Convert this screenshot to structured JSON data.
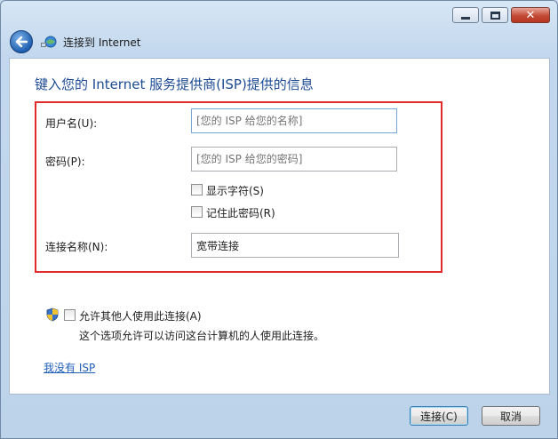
{
  "window": {
    "title": "连接到 Internet",
    "caption_buttons": [
      "minimize-icon",
      "maximize-icon",
      "close-icon"
    ]
  },
  "main": {
    "heading": "键入您的 Internet 服务提供商(ISP)提供的信息",
    "username": {
      "label": "用户名(U):",
      "placeholder": "[您的 ISP 给您的名称]",
      "value": ""
    },
    "password": {
      "label": "密码(P):",
      "placeholder": "[您的 ISP 给您的密码]",
      "value": ""
    },
    "show_chars": {
      "label": "显示字符(S)",
      "checked": false
    },
    "remember_pw": {
      "label": "记住此密码(R)",
      "checked": false
    },
    "conn_name": {
      "label": "连接名称(N):",
      "value": "宽带连接"
    },
    "allow_others": {
      "label": "允许其他人使用此连接(A)",
      "desc": "这个选项允许可以访问这台计算机的人使用此连接。",
      "checked": false,
      "icon": "shield-icon"
    },
    "no_isp_link": "我没有 ISP"
  },
  "footer": {
    "connect_label": "连接(C)",
    "cancel_label": "取消"
  },
  "colors": {
    "heading": "#1c4b94",
    "highlight_box": "#e32a2a",
    "link": "#1f5fb8"
  }
}
